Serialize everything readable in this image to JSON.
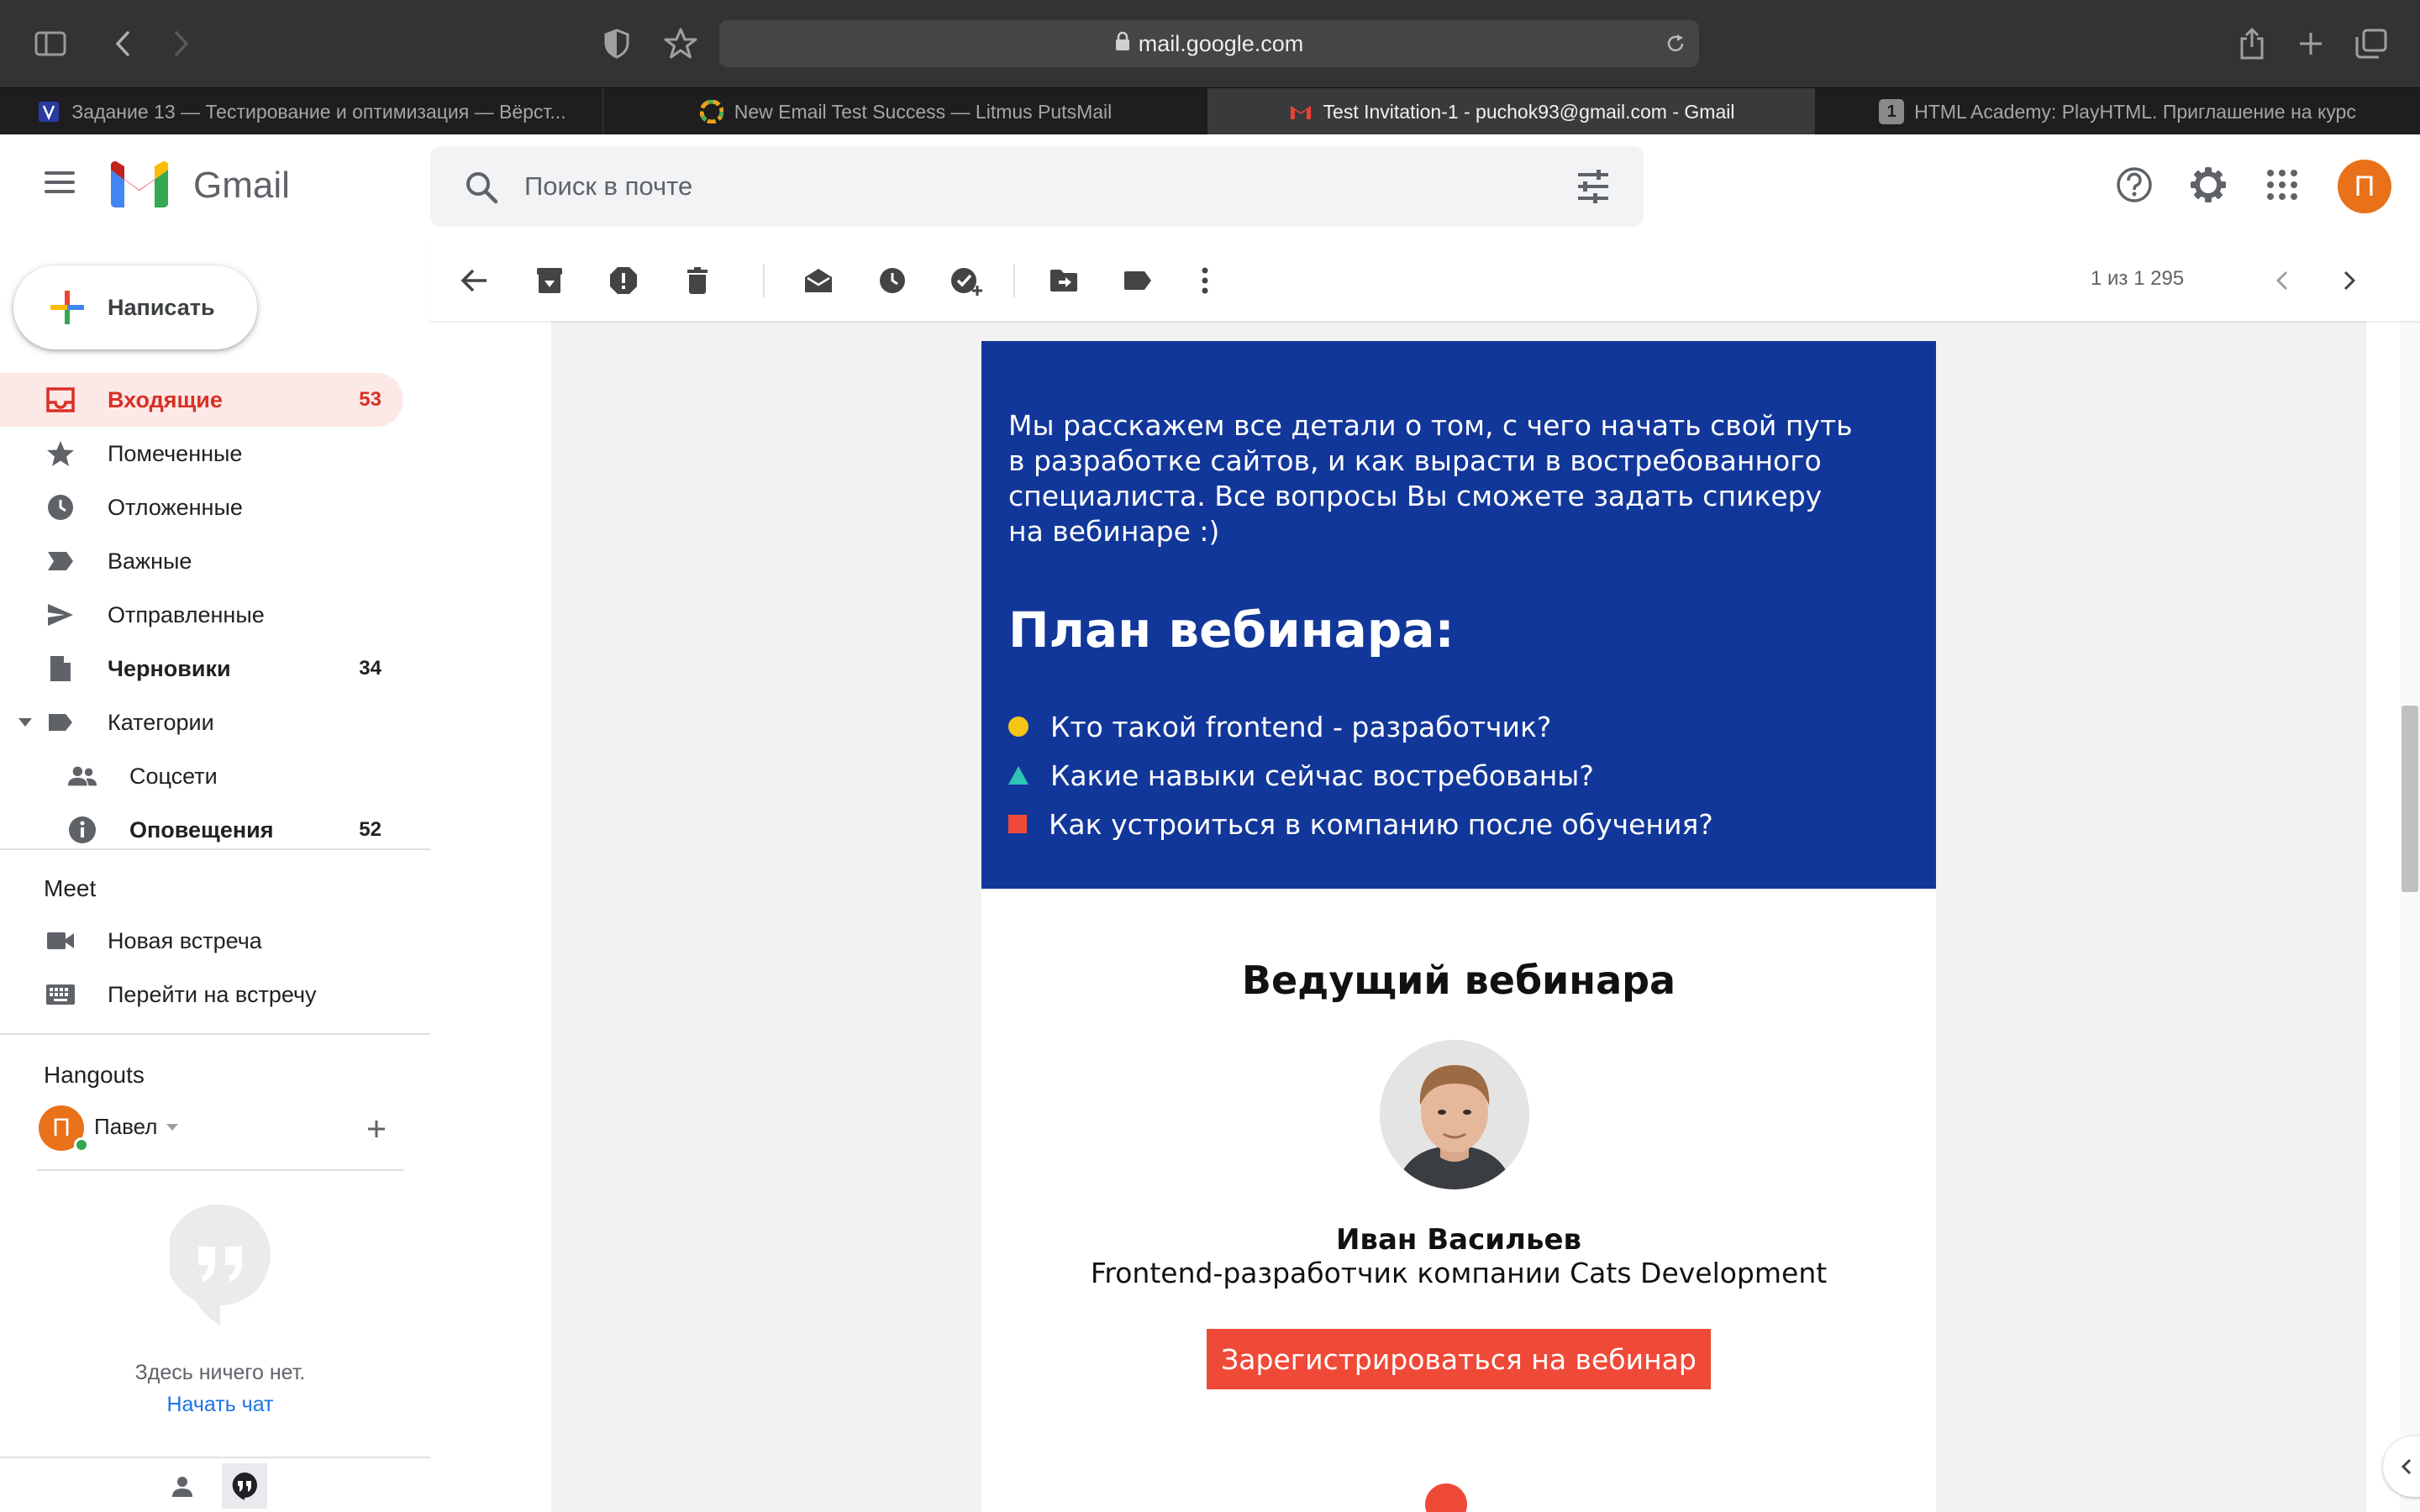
{
  "browser": {
    "url": "mail.google.com",
    "tabs": [
      {
        "title": "Задание 13 — Тестирование и оптимизация — Вёрст...",
        "active": false
      },
      {
        "title": "New Email Test Success — Litmus PutsMail",
        "active": false
      },
      {
        "title": "Test Invitation-1 - puchok93@gmail.com - Gmail",
        "active": true
      },
      {
        "title": "HTML Academy: PlayHTML. Приглашение на курс",
        "active": false,
        "badge": "1"
      }
    ]
  },
  "header": {
    "product": "Gmail",
    "search_placeholder": "Поиск в почте",
    "avatar_letter": "П"
  },
  "sidebar": {
    "compose_label": "Написать",
    "items": [
      {
        "label": "Входящие",
        "count": "53",
        "icon": "inbox-icon"
      },
      {
        "label": "Помеченные",
        "count": "",
        "icon": "star-icon"
      },
      {
        "label": "Отложенные",
        "count": "",
        "icon": "clock-icon"
      },
      {
        "label": "Важные",
        "count": "",
        "icon": "important-icon"
      },
      {
        "label": "Отправленные",
        "count": "",
        "icon": "send-icon"
      },
      {
        "label": "Черновики",
        "count": "34",
        "icon": "draft-icon"
      },
      {
        "label": "Категории",
        "count": "",
        "icon": "label-icon"
      },
      {
        "label": "Соцсети",
        "count": "",
        "icon": "people-icon"
      },
      {
        "label": "Оповещения",
        "count": "52",
        "icon": "info-icon"
      }
    ],
    "meet": {
      "title": "Meet",
      "new_meeting": "Новая встреча",
      "join_meeting": "Перейти на встречу"
    },
    "hangouts": {
      "title": "Hangouts",
      "user_name": "Павел",
      "user_letter": "П",
      "empty_text": "Здесь ничего нет.",
      "start_chat": "Начать чат"
    }
  },
  "toolbar": {
    "pager": "1 из 1 295"
  },
  "email": {
    "intro": "Мы расскажем все детали о том, с чего начать свой путь в разработке сайтов, и как вырасти в востребованного специалиста. Все вопросы Вы сможете задать спикеру на вебинаре :)",
    "plan_title": "План вебинара:",
    "plan_items": [
      "Кто такой frontend - разработчик?",
      "Какие навыки сейчас востребованы?",
      "Как устроиться в компанию после обучения?"
    ],
    "host_title": "Ведущий вебинара",
    "host_name": "Иван Васильев",
    "host_role": "Frontend-разработчик компании Cats Development",
    "cta_label": "Зарегистрироваться на вебинар"
  },
  "colors": {
    "email_blue": "#12379a",
    "accent_red": "#ef4a38",
    "bullet_yellow": "#f5c518",
    "bullet_teal": "#2ec4b6",
    "gmail_active": "#d93025"
  }
}
